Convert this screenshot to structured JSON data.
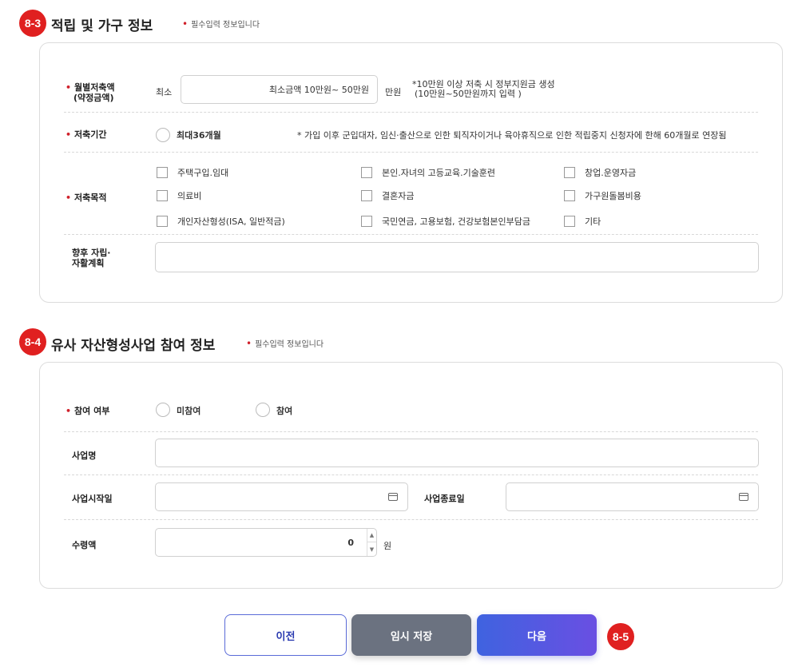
{
  "section1": {
    "badge": "8-3",
    "title": "적립 및 가구 정보",
    "required_note": "필수입력 정보입니다",
    "monthly_savings": {
      "label_line1": "월별저축액",
      "label_line2": "(약정금액)",
      "prefix": "최소",
      "value": "최소금액 10만원~ 50만원",
      "unit": "만원",
      "note_line1": "*10만원 이상 저축 시 정부지원금 생성",
      "note_line2": "(10만원~50만원까지 입력 )"
    },
    "savings_period": {
      "label": "저축기간",
      "option": "최대36개월",
      "note": "* 가입 이후 군입대자, 임신·출산으로 인한 퇴직자이거나 육아휴직으로 인한 적립중지 신청자에 한해 60개월로 연장됨"
    },
    "savings_purpose": {
      "label": "저축목적",
      "options": [
        "주택구입.임대",
        "본인.자녀의 고등교육.기술훈련",
        "창업.운영자금",
        "의료비",
        "결혼자금",
        "가구원돌봄비용",
        "개인자산형성(ISA, 일반적금)",
        "국민연금, 고용보험, 건강보험본인부담금",
        "기타"
      ]
    },
    "future_plan": {
      "label_line1": "향후 자립·",
      "label_line2": "자활계획",
      "value": ""
    }
  },
  "section2": {
    "badge": "8-4",
    "title": "유사 자산형성사업 참여 정보",
    "required_note": "필수입력 정보입니다",
    "participation": {
      "label": "참여 여부",
      "options": [
        "미참여",
        "참여"
      ]
    },
    "business_name": {
      "label": "사업명",
      "value": ""
    },
    "start_date": {
      "label": "사업시작일",
      "value": ""
    },
    "end_date": {
      "label": "사업종료일",
      "value": ""
    },
    "amount": {
      "label": "수령액",
      "value": "0",
      "unit": "원"
    }
  },
  "buttons": {
    "prev": "이전",
    "temp_save": "임시 저장",
    "next": "다음",
    "badge": "8-5"
  },
  "colors": {
    "badge": "#e02020",
    "required": "#d0202a",
    "next_button_start": "#3f63e0",
    "next_button_end": "#6a4fe2",
    "temp_button": "#6b7280"
  }
}
